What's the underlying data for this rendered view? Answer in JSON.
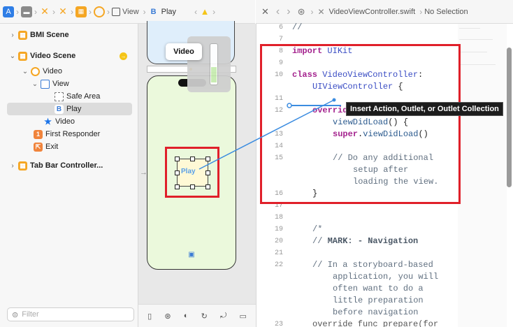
{
  "jumpbar_left": {
    "items": [
      "View",
      "Play"
    ]
  },
  "jumpbar_right": {
    "file": "VideoViewController.swift",
    "selection": "No Selection"
  },
  "navigator": {
    "rows": [
      {
        "label": "BMI Scene",
        "bold": true
      },
      {
        "label": "Video Scene",
        "bold": true
      },
      {
        "label": "Video"
      },
      {
        "label": "View"
      },
      {
        "label": "Safe Area"
      },
      {
        "label": "Play"
      },
      {
        "label": "Video"
      },
      {
        "label": "First Responder"
      },
      {
        "label": "Exit"
      },
      {
        "label": "Tab Bar Controller...",
        "bold": true
      }
    ],
    "filter_placeholder": "Filter"
  },
  "canvas": {
    "tooltip": "Video",
    "button_label": "Play"
  },
  "editor": {
    "line_numbers": [
      "6",
      "7",
      "8",
      "9",
      "10",
      "11",
      "12",
      "13",
      "14",
      "15",
      "16",
      "17",
      "18",
      "19",
      "20",
      "21",
      "22",
      "23"
    ],
    "connection_tooltip": "Insert Action, Outlet, or Outlet Collection",
    "code": {
      "l6": "//",
      "l8_kw": "import",
      "l8_ty": " UIKit",
      "l10_kw": "class",
      "l10_ty": " VideoViewController",
      "l10_rest": ":",
      "l10b_ty": "UIViewController",
      "l10b_rest": " {",
      "l12_kw": "override",
      "l12b_fn": "viewDidLoad",
      "l12b_rest": "() {",
      "l13_kw": "super",
      "l13_rest": ".",
      "l13_fn": "viewDidLoad",
      "l13_end": "()",
      "l15a": "// Do any additional",
      "l15b": "setup after",
      "l15c": "loading the view.",
      "l16": "}",
      "l19": "/*",
      "l20_a": "// ",
      "l20_b": "MARK: - Navigation",
      "l22a": "// In a storyboard-based",
      "l22b": "application, you will",
      "l22c": "often want to do a",
      "l22d": "little preparation",
      "l22e": "before navigation",
      "l23": "override func prepare(for"
    }
  }
}
